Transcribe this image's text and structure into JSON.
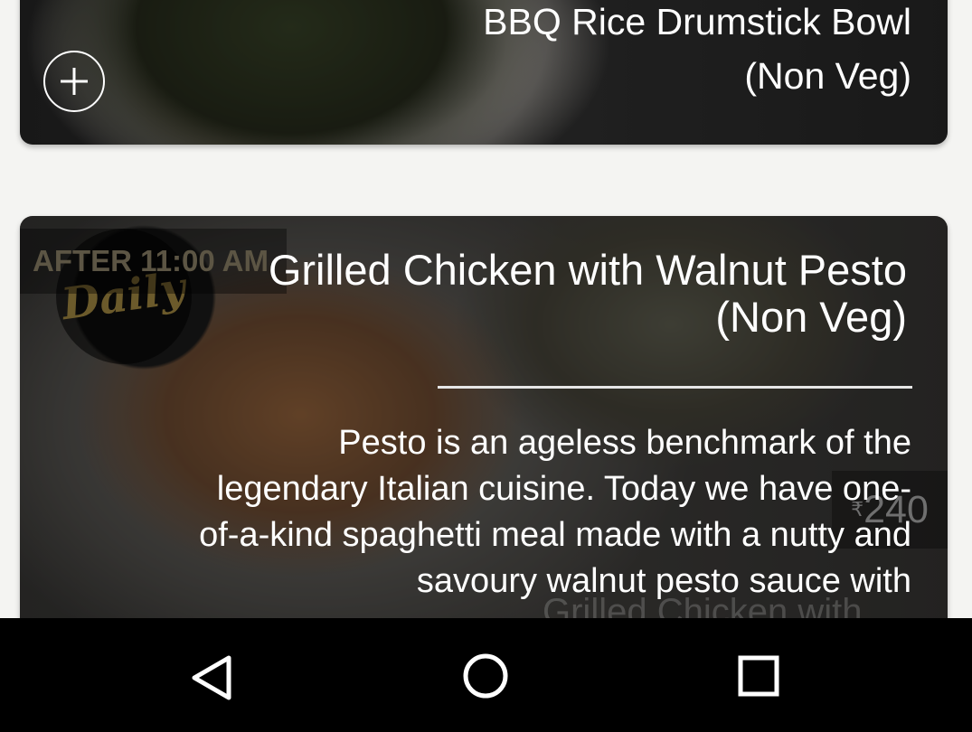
{
  "cards": [
    {
      "title": "BBQ Rice Drumstick Bowl (Non Veg)",
      "add_icon": "plus-circle-icon"
    },
    {
      "availability": "AFTER 11:00 AM",
      "logo_text": "Daily",
      "title": "Grilled Chicken with Walnut Pesto (Non Veg)",
      "description": "Pesto is an ageless benchmark of the legendary Italian cuisine. Today we have one-of-a-kind spaghetti meal made with a nutty and savoury walnut pesto sauce with",
      "price_symbol": "₹",
      "price": "240",
      "image_caption": "Grilled Chicken with"
    }
  ],
  "nav": {
    "back_icon": "back-triangle-icon",
    "home_icon": "home-circle-icon",
    "recent_icon": "recent-apps-square-icon"
  }
}
